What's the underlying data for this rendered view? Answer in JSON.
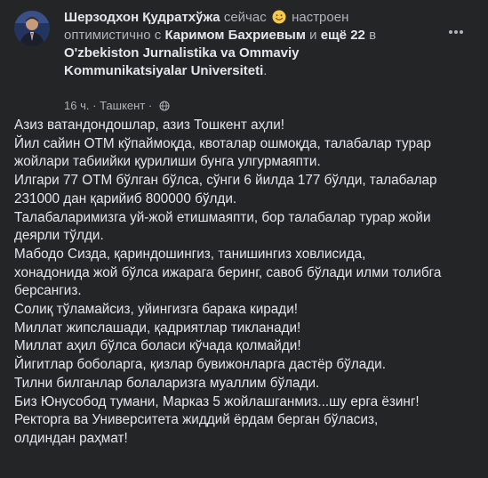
{
  "author": {
    "name": "Шерзодхон Қудратхўжа",
    "status_before": "сейчас",
    "emoji": "smiling-face-emoji",
    "status_after": "настроен оптимистично с",
    "tagged_person": "Каримом Бахриевым",
    "and_word": "и",
    "others": "ещё 22",
    "in_word": "в",
    "place_line1": "O'zbekiston Jurnalistika va Ommaviy Kommunikatsiyalar",
    "place_line2": "Universiteti",
    "place_dot": "."
  },
  "meta": {
    "time": "16 ч.",
    "separator": "·",
    "location": "Ташкент",
    "separator2": "·",
    "audience_icon": "globe-icon"
  },
  "post_lines": [
    "Азиз ватандондошлар, азиз Тошкент аҳли!",
    "Йил сайин ОТМ кўпаймоқда, квоталар ошмоқда, талабалар турар",
    "жойлари табиийки қурилиши бунга улгурмаяпти.",
    "Илгари 77 ОТМ бўлган бўлса, сўнги 6 йилда 177 бўлди, талабалар",
    "231000 дан қарийиб 800000 бўлди.",
    "Талабаларимизга уй-жой етишмаяпти, бор талабалар турар жойи",
    "деярли тўлди.",
    "Мабодо Сизда, қариндошингиз, танишингиз ховлисида,",
    "хонадонида жой бўлса ижарага беринг, савоб бўлади илми толибга",
    "берсангиз.",
    "Солиқ тўламайсиз, уйингизга барака киради!",
    "Миллат жипслашади, қадриятлар тикланади!",
    "Миллат аҳил бўлса боласи кўчада қолмайди!",
    "Йигитлар боболарга, қизлар бувижонларга дастёр бўлади.",
    "Тилни билганлар болаларизга муаллим бўлади.",
    "Биз Юнусобод тумани, Марказ 5 жойлашганмиз...шу ерга ёзинг!",
    "Ректорга ва Университета жиддий ёрдам берган бўласиз,",
    "олдиндан раҳмат!"
  ],
  "colors": {
    "background": "#242526",
    "primary_text": "#e4e6eb",
    "secondary_text": "#b0b3b8"
  }
}
